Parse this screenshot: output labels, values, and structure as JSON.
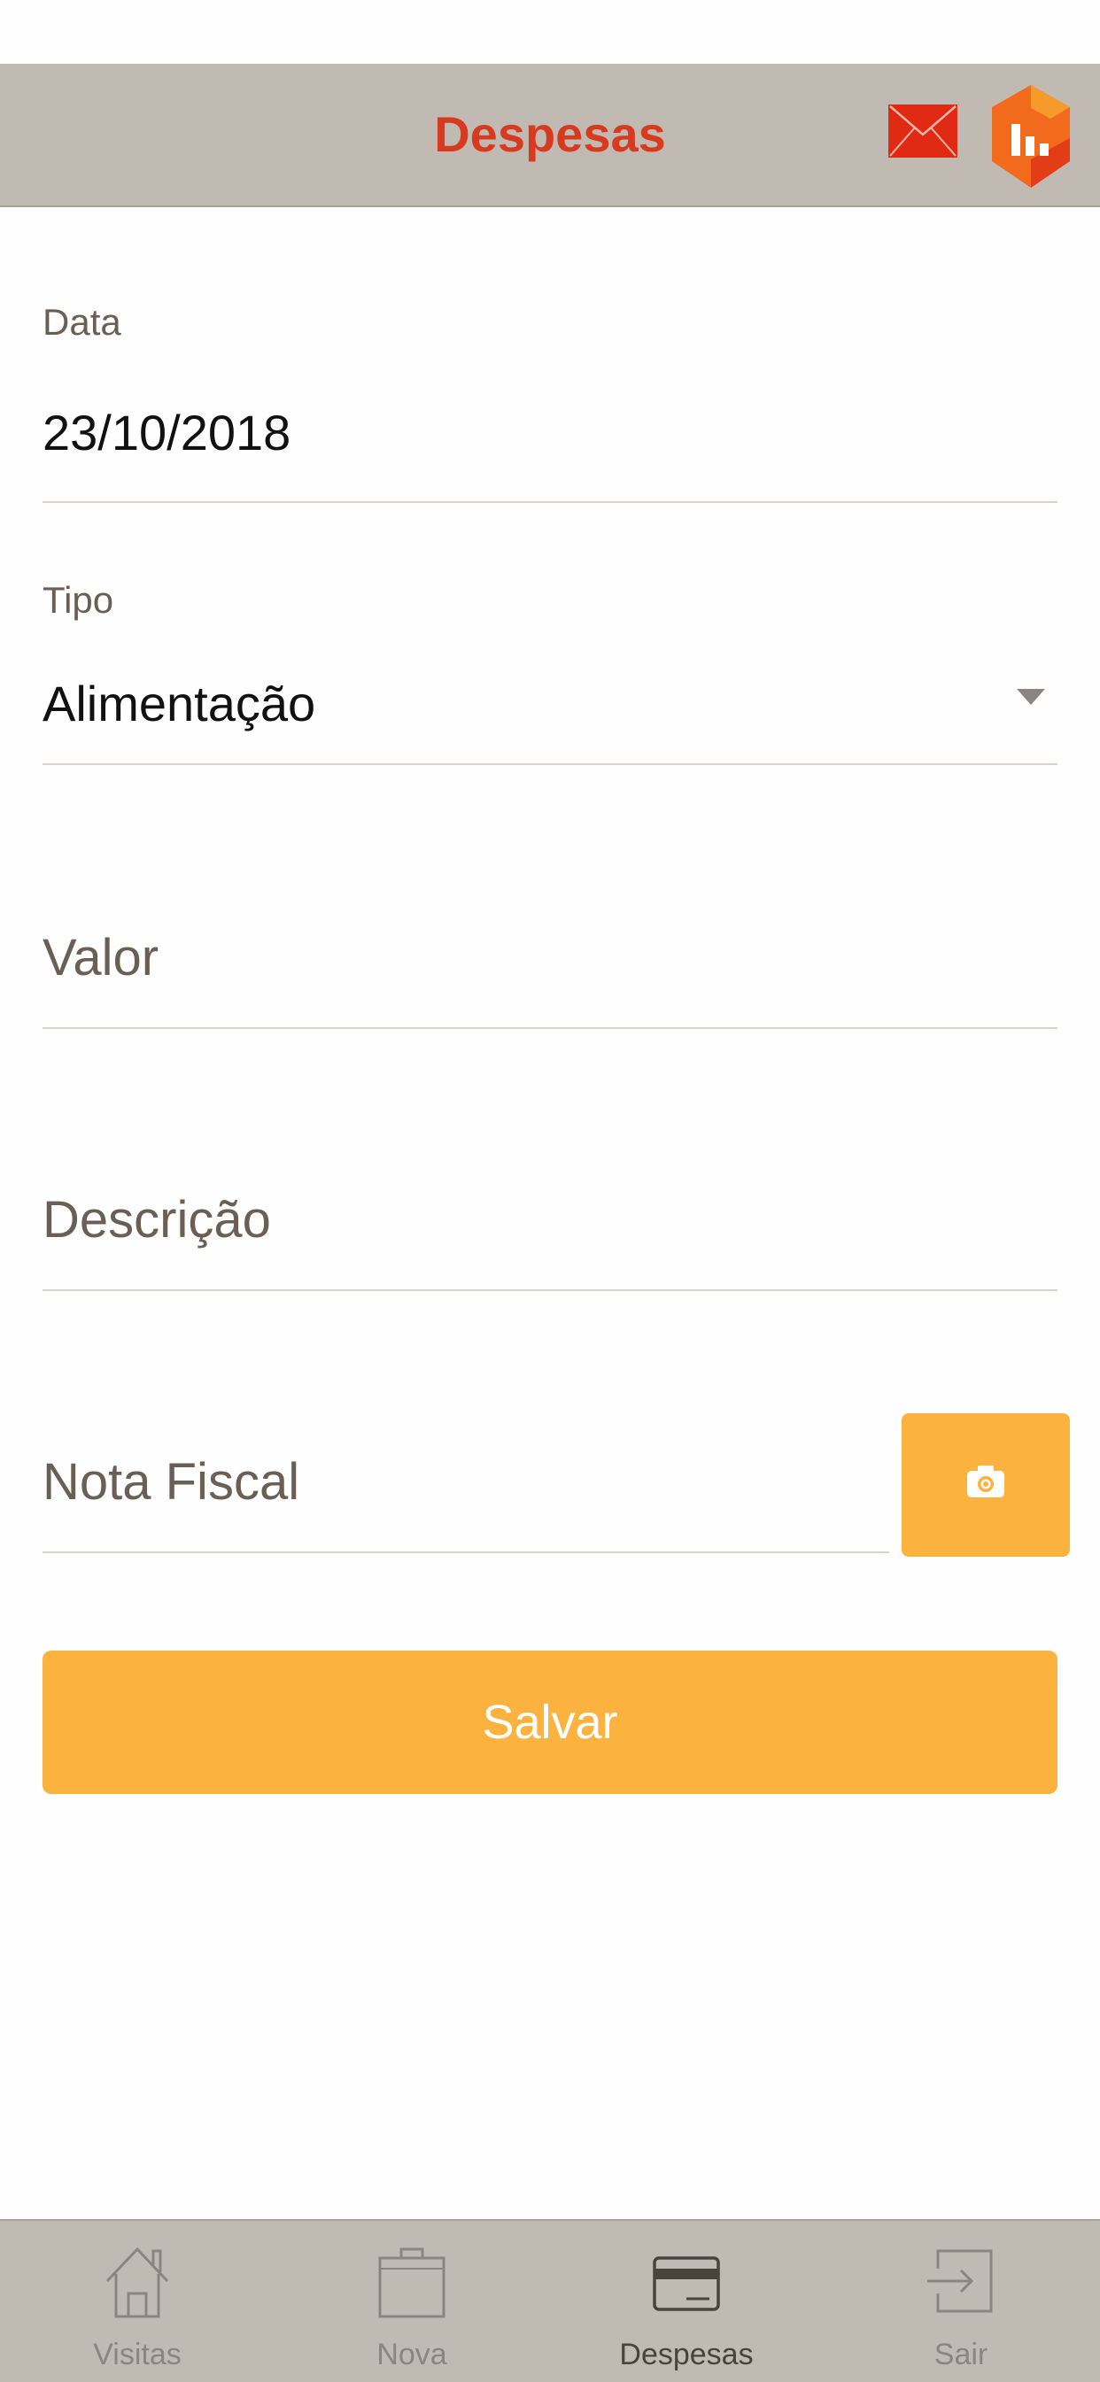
{
  "header": {
    "title": "Despesas",
    "mail_icon": "envelope-icon",
    "logo_icon": "app-logo-icon"
  },
  "form": {
    "data": {
      "label": "Data",
      "value": "23/10/2018"
    },
    "tipo": {
      "label": "Tipo",
      "value": "Alimentação"
    },
    "valor": {
      "placeholder": "Valor"
    },
    "descricao": {
      "placeholder": "Descrição"
    },
    "nota_fiscal": {
      "placeholder": "Nota Fiscal",
      "camera_icon": "camera-icon"
    },
    "save_label": "Salvar"
  },
  "tabbar": {
    "active": "Despesas",
    "tabs": [
      {
        "label": "Visitas",
        "icon": "house-icon"
      },
      {
        "label": "Nova",
        "icon": "briefcase-icon"
      },
      {
        "label": "Despesas",
        "icon": "credit-card-icon"
      },
      {
        "label": "Sair",
        "icon": "logout-icon"
      }
    ]
  },
  "colors": {
    "header_bg": "#c1bab2",
    "title_red": "#d83a1f",
    "accent_orange": "#fcb23f",
    "label_brown": "#6a5f55"
  }
}
